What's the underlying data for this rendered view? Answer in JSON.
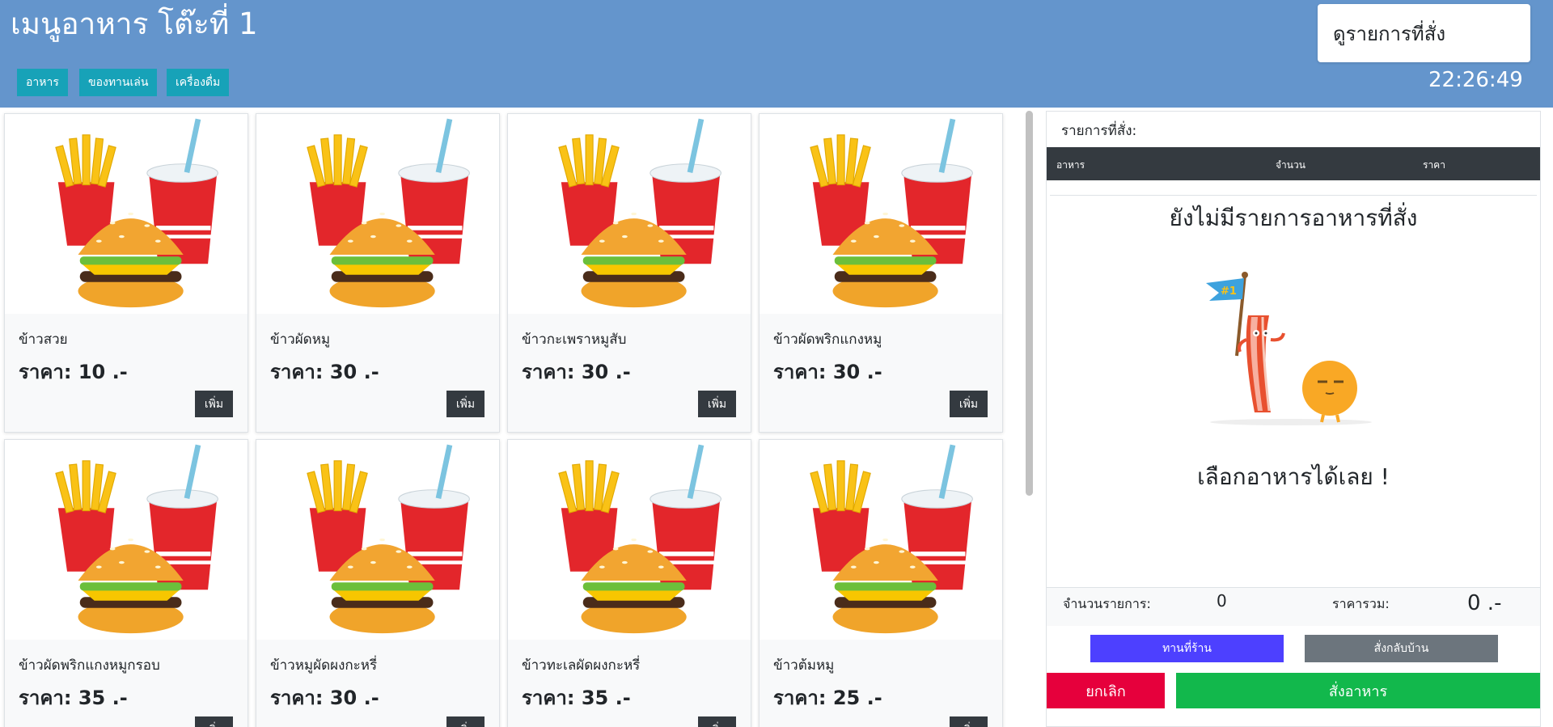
{
  "header": {
    "title": "เมนูอาหาร โต๊ะที่ 1",
    "categories": [
      "อาหาร",
      "ของทานเล่น",
      "เครื่องดื่ม"
    ],
    "view_orders_label": "ดูรายการที่สั่ง",
    "clock": "22:26:49",
    "color": "#6495cc"
  },
  "menu": {
    "price_prefix": "ราคา:",
    "add_label": "เพิ่ม",
    "image_icon": "burger-fries-drink-icon",
    "items": [
      {
        "name": "ข้าวสวย",
        "price": "10 .-"
      },
      {
        "name": "ข้าวผัดหมู",
        "price": "30 .-"
      },
      {
        "name": "ข้าวกะเพราหมูสับ",
        "price": "30 .-"
      },
      {
        "name": "ข้าวผัดพริกแกงหมู",
        "price": "30 .-"
      },
      {
        "name": "ข้าวผัดพริกแกงหมูกรอบ",
        "price": "35 .-"
      },
      {
        "name": "ข้าวหมูผัดผงกะหรี่",
        "price": "30 .-"
      },
      {
        "name": "ข้าวทะเลผัดผงกะหรี่",
        "price": "35 .-"
      },
      {
        "name": "ข้าวต้มหมู",
        "price": "25 .-"
      }
    ]
  },
  "order": {
    "label": "รายการที่สั่ง:",
    "columns": [
      "อาหาร",
      "จำนวน",
      "ราคา"
    ],
    "empty_title": "ยังไม่มีรายการอาหารที่สั่ง",
    "empty_icon": "bacon-mascot-icon",
    "empty_subtitle": "เลือกอาหารได้เลย !",
    "count_label": "จำนวนรายการ:",
    "count": "0",
    "total_label": "ราคารวม:",
    "total": "0 .-",
    "dine_in_label": "ทานที่ร้าน",
    "takeaway_label": "สั่งกลับบ้าน",
    "cancel_label": "ยกเลิก",
    "submit_label": "สั่งอาหาร",
    "colors": {
      "dine_in": "#4d40ff",
      "takeaway": "#6c757d",
      "cancel": "#e6003c",
      "submit": "#12b84c"
    }
  }
}
